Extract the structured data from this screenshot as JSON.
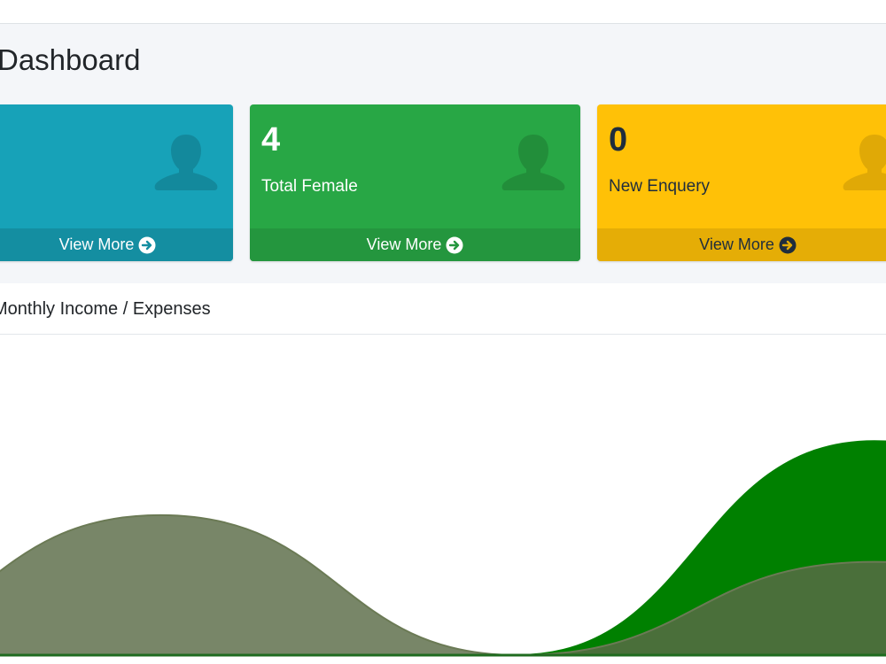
{
  "page": {
    "title": "Dashboard"
  },
  "boxes": [
    {
      "number": "",
      "label": "",
      "footer": "View More",
      "color": "#17a2b8"
    },
    {
      "number": "4",
      "label": "Total Female",
      "footer": "View More",
      "color": "#28a745"
    },
    {
      "number": "0",
      "label": "New Enquery",
      "footer": "View More",
      "color": "#ffc107"
    }
  ],
  "card": {
    "title": "Monthly Income / Expenses"
  },
  "icons": {
    "box_icon": "user-icon",
    "footer_icon": "arrow-circle-right-icon"
  },
  "chart_data": {
    "type": "area",
    "title": "",
    "xlabel": "",
    "ylabel": "",
    "x": [
      0,
      1,
      2,
      3,
      4
    ],
    "ylim": [
      0,
      100
    ],
    "series": [
      {
        "values": [
          0,
          51,
          0,
          34,
          0
        ],
        "color": "#5a6b47"
      },
      {
        "values": [
          0,
          0,
          0,
          78,
          0
        ],
        "color": "#008000"
      }
    ],
    "grid": false,
    "legend": "none"
  }
}
